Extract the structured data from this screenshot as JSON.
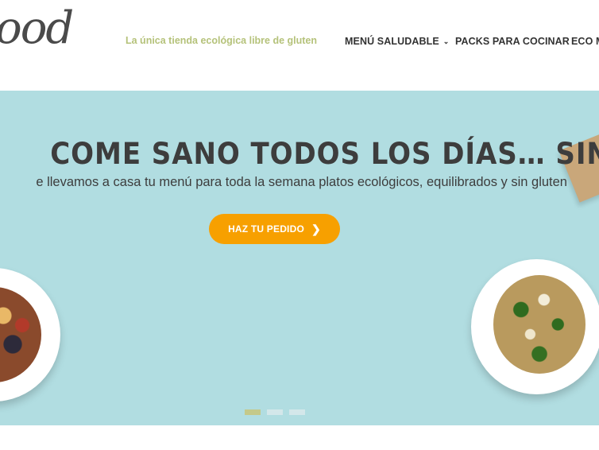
{
  "header": {
    "logo_text": "ood",
    "tagline": "La única tienda ecológica libre de gluten",
    "nav": [
      {
        "label": "MENÚ SALUDABLE",
        "has_dropdown": true
      },
      {
        "label": "PACKS PARA COCINAR",
        "has_dropdown": false
      },
      {
        "label": "ECO M",
        "has_dropdown": false
      }
    ]
  },
  "hero": {
    "title": "COME SANO TODOS LOS DÍAS… SIN COCINAR!",
    "subtitle": "e llevamos a casa tu menú para toda la semana platos ecológicos, equilibrados y sin gluten",
    "cta_label": "HAZ TU PEDIDO",
    "cta_icon": "chevron-right-icon",
    "slides": 3,
    "active_slide": 1
  },
  "colors": {
    "hero_bg": "#b1dde1",
    "cta": "#f7a000",
    "tagline": "#b5c27a",
    "active_dot": "#c4c98a"
  }
}
